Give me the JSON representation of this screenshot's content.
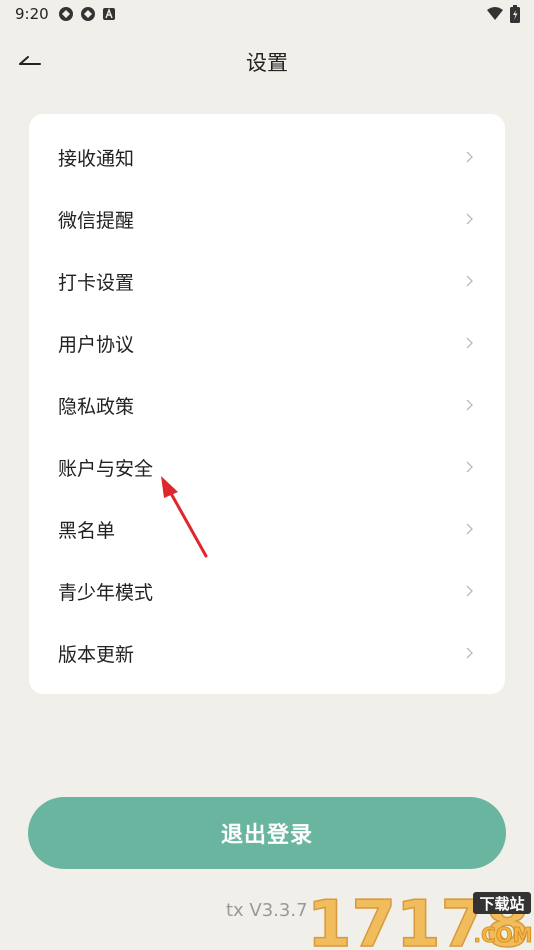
{
  "status_bar": {
    "time": "9:20",
    "left_icons": [
      "sync-icon",
      "sync-icon",
      "notification-a-icon"
    ],
    "right_icons": [
      "wifi-icon",
      "battery-icon"
    ]
  },
  "header": {
    "title": "设置",
    "back_icon": "arrow-left-icon"
  },
  "settings": {
    "items": [
      {
        "label": "接收通知"
      },
      {
        "label": "微信提醒"
      },
      {
        "label": "打卡设置"
      },
      {
        "label": "用户协议"
      },
      {
        "label": "隐私政策"
      },
      {
        "label": "账户与安全"
      },
      {
        "label": "黑名单"
      },
      {
        "label": "青少年模式"
      },
      {
        "label": "版本更新"
      }
    ]
  },
  "logout": {
    "label": "退出登录"
  },
  "version": {
    "text": "tx V3.3.7"
  },
  "watermark": {
    "number": "17178",
    "badge": "下载站",
    "suffix": ".COM"
  },
  "colors": {
    "background": "#f0efea",
    "card": "#ffffff",
    "accent": "#6ab5a0",
    "annotation_arrow": "#e0262b"
  }
}
